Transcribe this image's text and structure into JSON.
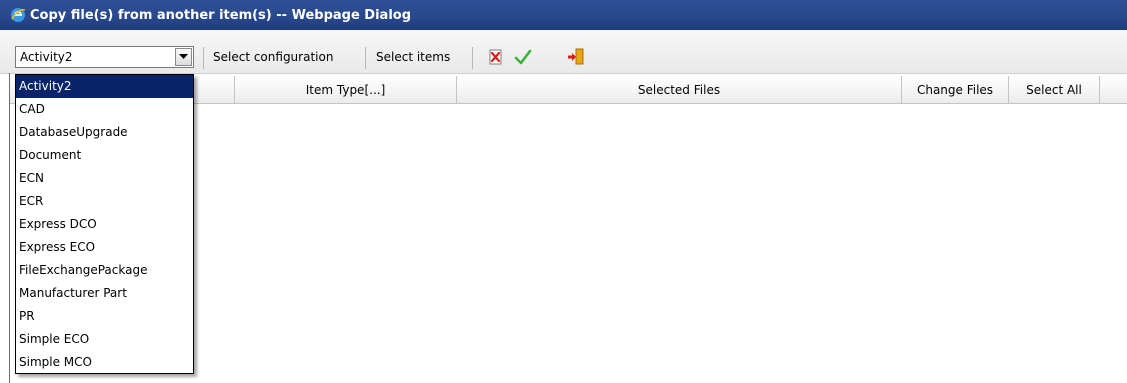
{
  "window": {
    "title": "Copy file(s) from another item(s) -- Webpage Dialog",
    "icon": "internet-explorer-icon"
  },
  "toolbar": {
    "item_type_select": {
      "value": "Activity2"
    },
    "select_configuration_label": "Select configuration",
    "select_items_label": "Select items",
    "icons": [
      "clear-icon",
      "checkmark-icon",
      "exit-icon"
    ]
  },
  "grid": {
    "columns": [
      "",
      "Item Type[...]",
      "Selected Files",
      "Change Files",
      "Select All"
    ]
  },
  "dropdown": {
    "options": [
      "Activity2",
      "CAD",
      "DatabaseUpgrade",
      "Document",
      "ECN",
      "ECR",
      "Express DCO",
      "Express ECO",
      "FileExchangePackage",
      "Manufacturer Part",
      "PR",
      "Simple ECO",
      "Simple MCO"
    ],
    "selected": "Activity2"
  },
  "colors": {
    "titlebar": "#2a4a8f",
    "selection": "#0a246a"
  }
}
